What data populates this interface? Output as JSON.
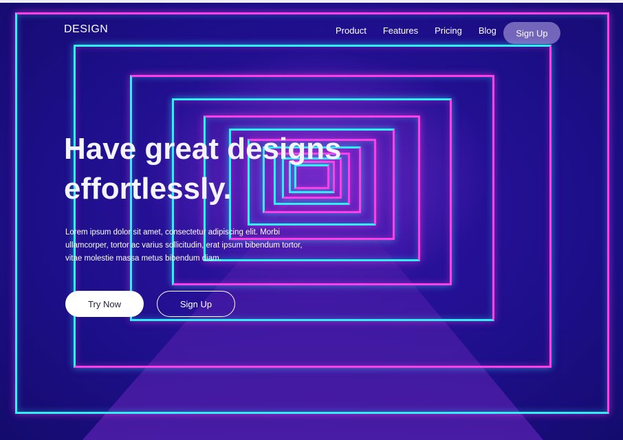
{
  "header": {
    "logo": "DESIGN",
    "nav": [
      {
        "label": "Product"
      },
      {
        "label": "Features"
      },
      {
        "label": "Pricing"
      },
      {
        "label": "Blog"
      }
    ],
    "signup_label": "Sign Up"
  },
  "hero": {
    "headline_line1": "Have great designs",
    "headline_line2": "effortlessly.",
    "body": "Lorem ipsum dolor sit amet, consectetur adipiscing elit. Morbi ullamcorper, tortor ac varius sollicitudin, erat ipsum bibendum tortor, vitae molestie massa metus bibendum diam.",
    "primary_cta": "Try Now",
    "secondary_cta": "Sign Up"
  },
  "colors": {
    "neon_pink": "#ff3ee6",
    "neon_cyan": "#2ef0ff",
    "background": "#1d0f8a"
  }
}
